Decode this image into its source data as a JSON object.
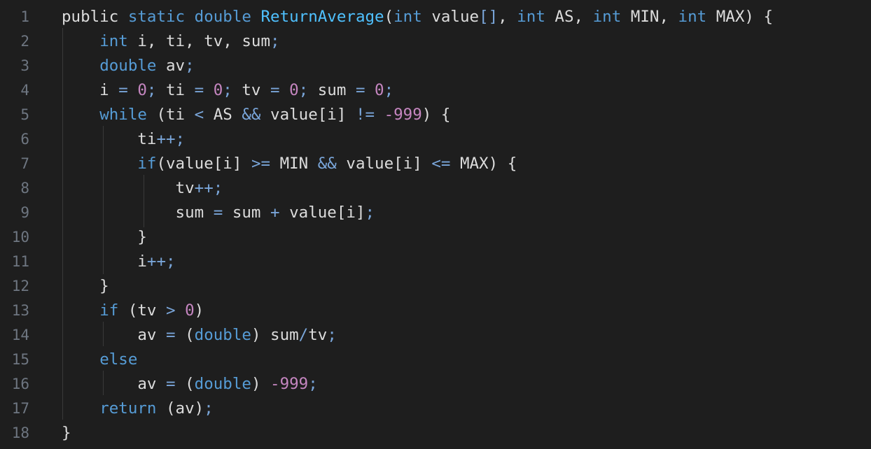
{
  "editor": {
    "lines": [
      {
        "num": "1",
        "tokens": [
          {
            "t": "public ",
            "c": "plain"
          },
          {
            "t": "static ",
            "c": "kw"
          },
          {
            "t": "double ",
            "c": "kw"
          },
          {
            "t": "ReturnAverage",
            "c": "fn"
          },
          {
            "t": "(",
            "c": "plain"
          },
          {
            "t": "int",
            "c": "kw"
          },
          {
            "t": " value",
            "c": "plain"
          },
          {
            "t": "[]",
            "c": "op"
          },
          {
            "t": ", ",
            "c": "plain"
          },
          {
            "t": "int",
            "c": "kw"
          },
          {
            "t": " AS, ",
            "c": "plain"
          },
          {
            "t": "int",
            "c": "kw"
          },
          {
            "t": " MIN, ",
            "c": "plain"
          },
          {
            "t": "int",
            "c": "kw"
          },
          {
            "t": " MAX) {",
            "c": "plain"
          }
        ]
      },
      {
        "num": "2",
        "tokens": [
          {
            "t": "    ",
            "c": "plain"
          },
          {
            "t": "int",
            "c": "kw"
          },
          {
            "t": " i, ti, tv, sum",
            "c": "plain"
          },
          {
            "t": ";",
            "c": "op"
          }
        ]
      },
      {
        "num": "3",
        "tokens": [
          {
            "t": "    ",
            "c": "plain"
          },
          {
            "t": "double",
            "c": "kw"
          },
          {
            "t": " av",
            "c": "plain"
          },
          {
            "t": ";",
            "c": "op"
          }
        ]
      },
      {
        "num": "4",
        "tokens": [
          {
            "t": "    i ",
            "c": "plain"
          },
          {
            "t": "=",
            "c": "op"
          },
          {
            "t": " ",
            "c": "plain"
          },
          {
            "t": "0",
            "c": "num"
          },
          {
            "t": ";",
            "c": "op"
          },
          {
            "t": " ti ",
            "c": "plain"
          },
          {
            "t": "=",
            "c": "op"
          },
          {
            "t": " ",
            "c": "plain"
          },
          {
            "t": "0",
            "c": "num"
          },
          {
            "t": ";",
            "c": "op"
          },
          {
            "t": " tv ",
            "c": "plain"
          },
          {
            "t": "=",
            "c": "op"
          },
          {
            "t": " ",
            "c": "plain"
          },
          {
            "t": "0",
            "c": "num"
          },
          {
            "t": ";",
            "c": "op"
          },
          {
            "t": " sum ",
            "c": "plain"
          },
          {
            "t": "=",
            "c": "op"
          },
          {
            "t": " ",
            "c": "plain"
          },
          {
            "t": "0",
            "c": "num"
          },
          {
            "t": ";",
            "c": "op"
          }
        ]
      },
      {
        "num": "5",
        "tokens": [
          {
            "t": "    ",
            "c": "plain"
          },
          {
            "t": "while",
            "c": "kw"
          },
          {
            "t": " (ti ",
            "c": "plain"
          },
          {
            "t": "<",
            "c": "op"
          },
          {
            "t": " AS ",
            "c": "plain"
          },
          {
            "t": "&&",
            "c": "op"
          },
          {
            "t": " value[i] ",
            "c": "plain"
          },
          {
            "t": "!=",
            "c": "op"
          },
          {
            "t": " ",
            "c": "plain"
          },
          {
            "t": "-999",
            "c": "num"
          },
          {
            "t": ") {",
            "c": "plain"
          }
        ]
      },
      {
        "num": "6",
        "tokens": [
          {
            "t": "        ti",
            "c": "plain"
          },
          {
            "t": "++;",
            "c": "op"
          }
        ]
      },
      {
        "num": "7",
        "tokens": [
          {
            "t": "        ",
            "c": "plain"
          },
          {
            "t": "if",
            "c": "kw"
          },
          {
            "t": "(value[i] ",
            "c": "plain"
          },
          {
            "t": ">=",
            "c": "op"
          },
          {
            "t": " MIN ",
            "c": "plain"
          },
          {
            "t": "&&",
            "c": "op"
          },
          {
            "t": " value[i] ",
            "c": "plain"
          },
          {
            "t": "<=",
            "c": "op"
          },
          {
            "t": " MAX) {",
            "c": "plain"
          }
        ]
      },
      {
        "num": "8",
        "tokens": [
          {
            "t": "            tv",
            "c": "plain"
          },
          {
            "t": "++;",
            "c": "op"
          }
        ]
      },
      {
        "num": "9",
        "tokens": [
          {
            "t": "            sum ",
            "c": "plain"
          },
          {
            "t": "=",
            "c": "op"
          },
          {
            "t": " sum ",
            "c": "plain"
          },
          {
            "t": "+",
            "c": "op"
          },
          {
            "t": " value[i]",
            "c": "plain"
          },
          {
            "t": ";",
            "c": "op"
          }
        ]
      },
      {
        "num": "10",
        "tokens": [
          {
            "t": "        }",
            "c": "plain"
          }
        ]
      },
      {
        "num": "11",
        "tokens": [
          {
            "t": "        i",
            "c": "plain"
          },
          {
            "t": "++;",
            "c": "op"
          }
        ]
      },
      {
        "num": "12",
        "tokens": [
          {
            "t": "    }",
            "c": "plain"
          }
        ]
      },
      {
        "num": "13",
        "tokens": [
          {
            "t": "    ",
            "c": "plain"
          },
          {
            "t": "if",
            "c": "kw"
          },
          {
            "t": " (tv ",
            "c": "plain"
          },
          {
            "t": ">",
            "c": "op"
          },
          {
            "t": " ",
            "c": "plain"
          },
          {
            "t": "0",
            "c": "num"
          },
          {
            "t": ")",
            "c": "plain"
          }
        ]
      },
      {
        "num": "14",
        "tokens": [
          {
            "t": "        av ",
            "c": "plain"
          },
          {
            "t": "=",
            "c": "op"
          },
          {
            "t": " (",
            "c": "plain"
          },
          {
            "t": "double",
            "c": "kw"
          },
          {
            "t": ") sum",
            "c": "plain"
          },
          {
            "t": "/",
            "c": "op"
          },
          {
            "t": "tv",
            "c": "plain"
          },
          {
            "t": ";",
            "c": "op"
          }
        ]
      },
      {
        "num": "15",
        "tokens": [
          {
            "t": "    ",
            "c": "plain"
          },
          {
            "t": "else",
            "c": "kw"
          }
        ]
      },
      {
        "num": "16",
        "tokens": [
          {
            "t": "        av ",
            "c": "plain"
          },
          {
            "t": "=",
            "c": "op"
          },
          {
            "t": " (",
            "c": "plain"
          },
          {
            "t": "double",
            "c": "kw"
          },
          {
            "t": ") ",
            "c": "plain"
          },
          {
            "t": "-999",
            "c": "num"
          },
          {
            "t": ";",
            "c": "op"
          }
        ]
      },
      {
        "num": "17",
        "tokens": [
          {
            "t": "    ",
            "c": "plain"
          },
          {
            "t": "return",
            "c": "kw"
          },
          {
            "t": " (av)",
            "c": "plain"
          },
          {
            "t": ";",
            "c": "op"
          }
        ]
      },
      {
        "num": "18",
        "tokens": [
          {
            "t": "}",
            "c": "plain"
          }
        ]
      }
    ]
  },
  "colors": {
    "background": "#1e1e1e",
    "line_number": "#6e7681",
    "keyword": "#569cd6",
    "function": "#4fc1ff",
    "number": "#c586c0",
    "operator": "#7aa6da",
    "text": "#dcdcdc"
  }
}
